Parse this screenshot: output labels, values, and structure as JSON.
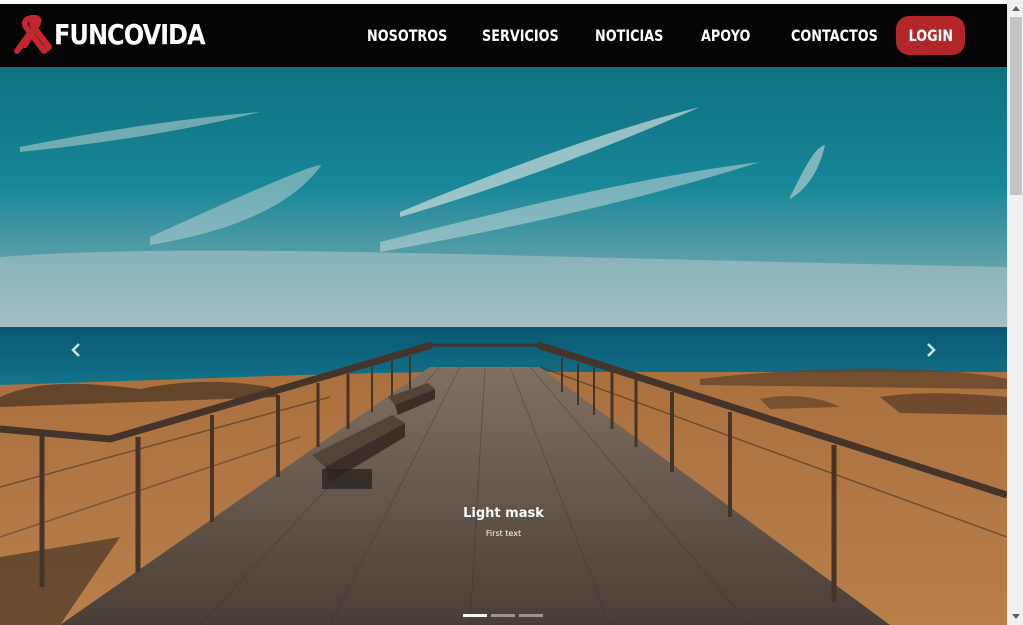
{
  "navbar": {
    "brand": "FUNCOVIDA",
    "links": [
      "NOSOTROS",
      "SERVICIOS",
      "NOTICIAS",
      "APOYO",
      "CONTACTOS"
    ],
    "login_label": "LOGIN"
  },
  "carousel": {
    "caption_title": "Light mask",
    "caption_text": "First text",
    "slide_count": 3,
    "active_slide": 1,
    "prev_icon": "chevron-left-icon",
    "next_icon": "chevron-right-icon"
  },
  "colors": {
    "navbar_bg": "#050505",
    "accent": "#b3262a",
    "text": "#ffffff"
  }
}
